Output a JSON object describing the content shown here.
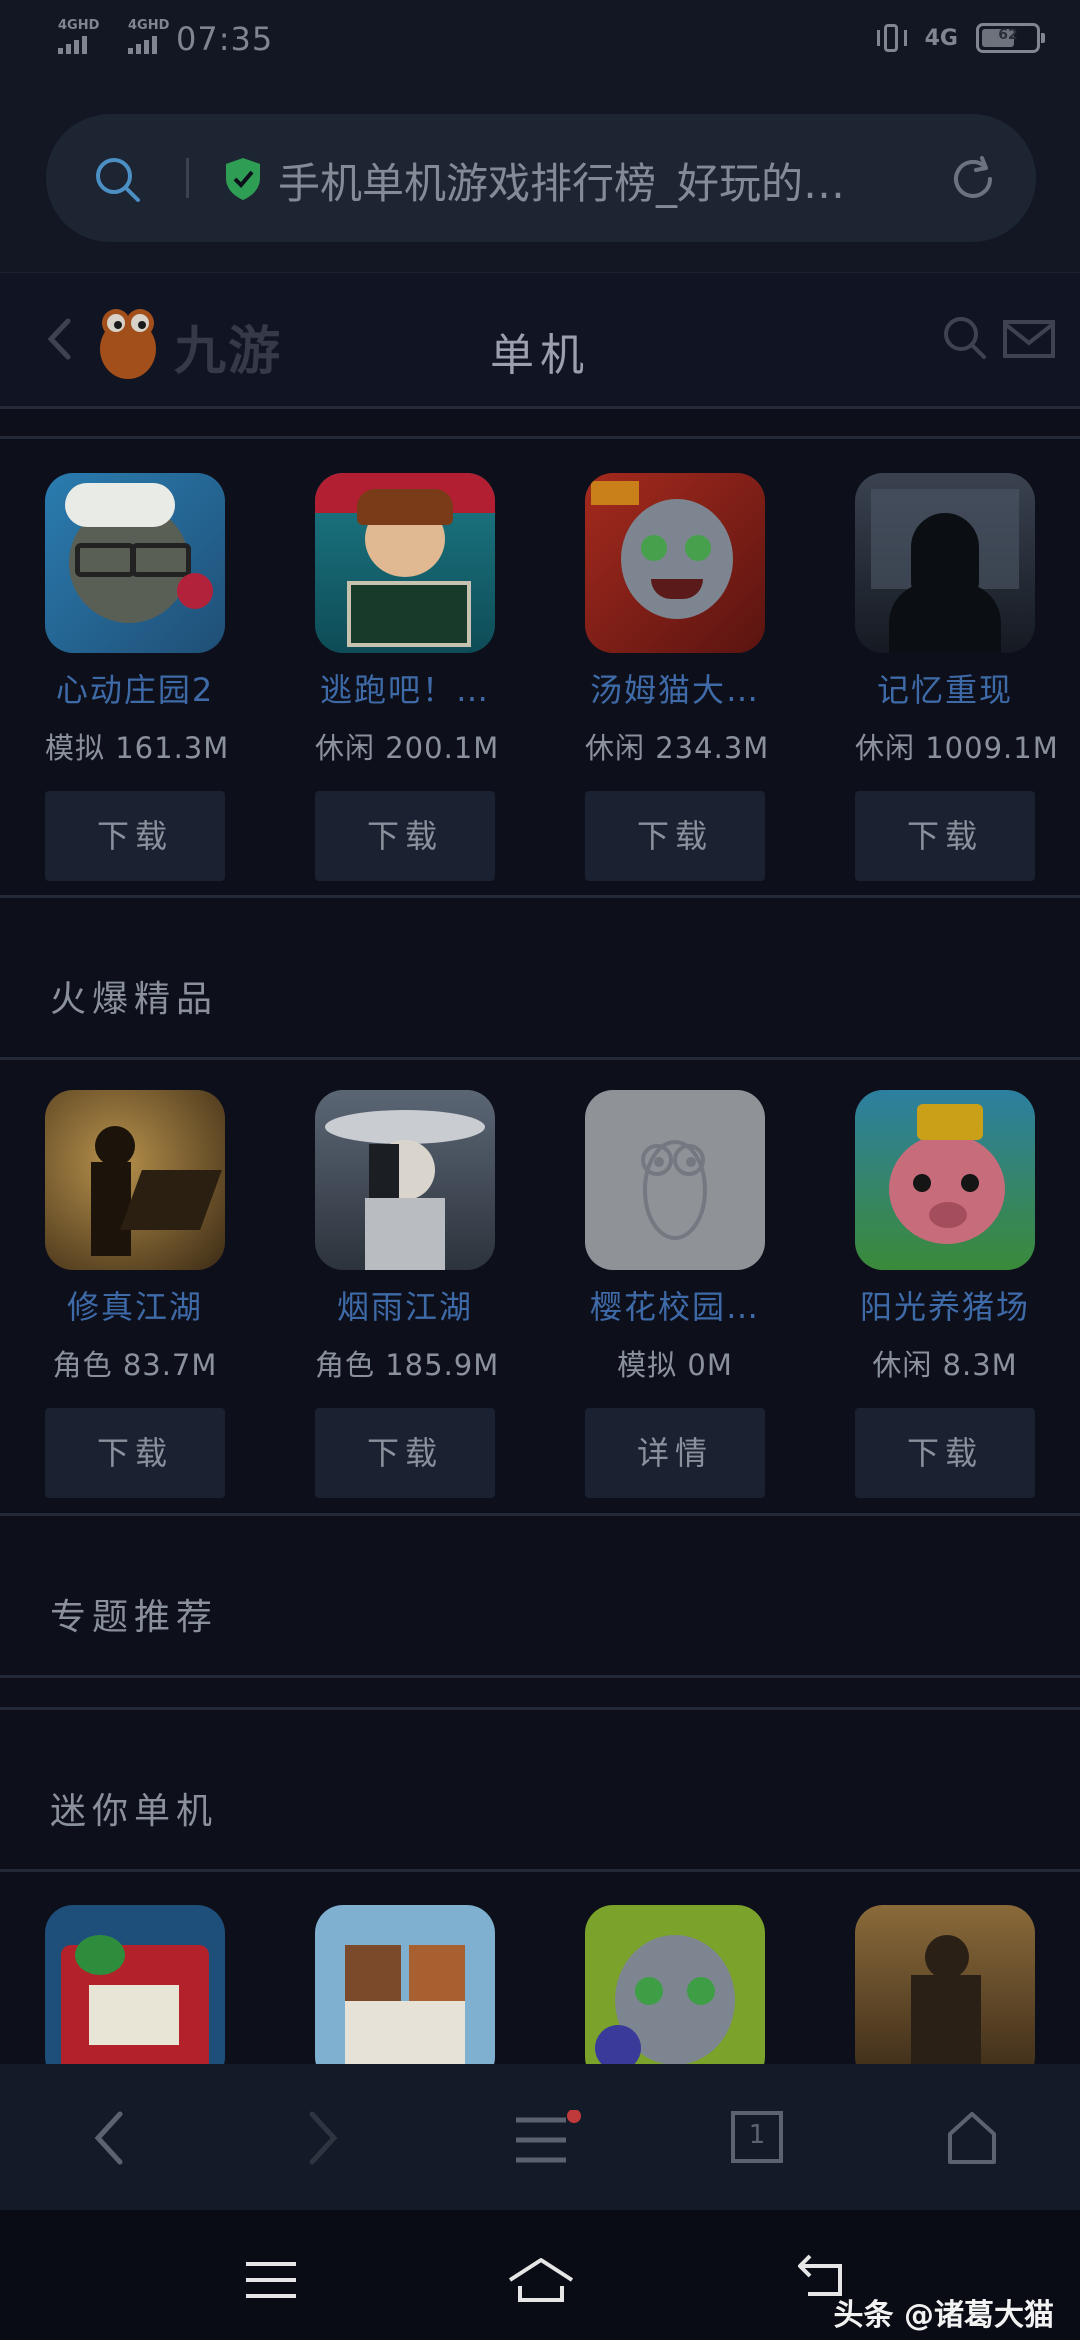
{
  "status_bar": {
    "network1": "4GHD",
    "network2": "4GHD",
    "time": "07:35",
    "signal_label": "4G",
    "battery_level_pct": 62
  },
  "browser": {
    "url_title": "手机单机游戏排行榜_好玩的…",
    "icons": [
      "search-icon",
      "shield-icon",
      "refresh-icon"
    ]
  },
  "site_header": {
    "logo_text": "九游",
    "title": "单机"
  },
  "top_games": [
    {
      "name": "心动庄园2",
      "category": "模拟",
      "size": "161.3M",
      "button": "下载"
    },
    {
      "name": "逃跑吧！…",
      "category": "休闲",
      "size": "200.1M",
      "button": "下载"
    },
    {
      "name": "汤姆猫大…",
      "category": "休闲",
      "size": "234.3M",
      "button": "下载"
    },
    {
      "name": "记忆重现",
      "category": "休闲",
      "size": "1009.1M",
      "button": "下载"
    }
  ],
  "hot_section": {
    "title": "火爆精品",
    "games": [
      {
        "name": "修真江湖",
        "category": "角色",
        "size": "83.7M",
        "button": "下载"
      },
      {
        "name": "烟雨江湖",
        "category": "角色",
        "size": "185.9M",
        "button": "下载"
      },
      {
        "name": "樱花校园…",
        "category": "模拟",
        "size": "0M",
        "button": "详情"
      },
      {
        "name": "阳光养猪场",
        "category": "休闲",
        "size": "8.3M",
        "button": "下载"
      }
    ]
  },
  "topic_section": {
    "title": "专题推荐"
  },
  "mini_section": {
    "title": "迷你单机"
  },
  "browser_nav": {
    "tab_count": "1",
    "icons": [
      "back-icon",
      "forward-icon",
      "menu-icon",
      "tabs-icon",
      "home-icon"
    ]
  },
  "watermark": "头条 @诸葛大猫",
  "colors": {
    "background": "#0d101b",
    "link": "#3f6aa8",
    "button": "#1a2232",
    "notification_dot": "#c0393b"
  }
}
